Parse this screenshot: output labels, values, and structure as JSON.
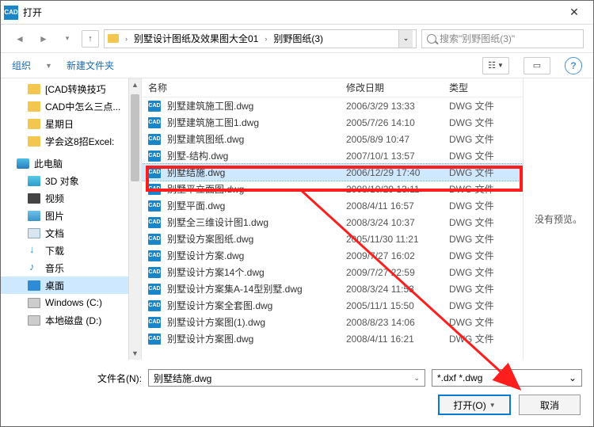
{
  "window": {
    "title": "打开"
  },
  "nav": {
    "crumbs": [
      "别墅设计图纸及效果图大全01",
      "别野图纸(3)"
    ],
    "search_placeholder": "搜索\"别野图纸(3)\""
  },
  "toolbar": {
    "organize": "组织",
    "newfolder": "新建文件夹"
  },
  "tree": {
    "items": [
      {
        "label": "[CAD转换技巧",
        "icon": "ico-folder",
        "level": 1
      },
      {
        "label": "CAD中怎么三点...",
        "icon": "ico-folder",
        "level": 1
      },
      {
        "label": "星期日",
        "icon": "ico-folder",
        "level": 1
      },
      {
        "label": "学会这8招Excel:",
        "icon": "ico-folder",
        "level": 1
      },
      {
        "label": "此电脑",
        "icon": "ico-pc",
        "level": 0,
        "hdr": true
      },
      {
        "label": "3D 对象",
        "icon": "ico-3d",
        "level": 1
      },
      {
        "label": "视频",
        "icon": "ico-video",
        "level": 1
      },
      {
        "label": "图片",
        "icon": "ico-pic",
        "level": 1
      },
      {
        "label": "文档",
        "icon": "ico-doc",
        "level": 1
      },
      {
        "label": "下载",
        "icon": "ico-dl",
        "level": 1
      },
      {
        "label": "音乐",
        "icon": "ico-music",
        "level": 1
      },
      {
        "label": "桌面",
        "icon": "ico-desktop",
        "level": 1,
        "sel": true
      },
      {
        "label": "Windows (C:)",
        "icon": "ico-disk",
        "level": 1
      },
      {
        "label": "本地磁盘 (D:)",
        "icon": "ico-disk",
        "level": 1
      }
    ]
  },
  "cols": {
    "name": "名称",
    "date": "修改日期",
    "type": "类型"
  },
  "files": [
    {
      "name": "别墅建筑施工图.dwg",
      "date": "2006/3/29 13:33",
      "type": "DWG 文件"
    },
    {
      "name": "别墅建筑施工图1.dwg",
      "date": "2005/7/26 14:10",
      "type": "DWG 文件"
    },
    {
      "name": "别墅建筑图纸.dwg",
      "date": "2005/8/9 10:47",
      "type": "DWG 文件"
    },
    {
      "name": "别墅-结构.dwg",
      "date": "2007/10/1 13:57",
      "type": "DWG 文件"
    },
    {
      "name": "别墅结施.dwg",
      "date": "2006/12/29 17:40",
      "type": "DWG 文件",
      "sel": true
    },
    {
      "name": "别墅平立面图.dwg",
      "date": "2008/10/29 13:11",
      "type": "DWG 文件"
    },
    {
      "name": "别墅平面.dwg",
      "date": "2008/4/11 16:57",
      "type": "DWG 文件"
    },
    {
      "name": "别墅全三维设计图1.dwg",
      "date": "2008/3/24 10:37",
      "type": "DWG 文件"
    },
    {
      "name": "别墅设方案图纸.dwg",
      "date": "2005/11/30 11:21",
      "type": "DWG 文件"
    },
    {
      "name": "别墅设计方案.dwg",
      "date": "2009/7/27 16:02",
      "type": "DWG 文件"
    },
    {
      "name": "别墅设计方案14个.dwg",
      "date": "2009/7/27 22:59",
      "type": "DWG 文件"
    },
    {
      "name": "别墅设计方案集A-14型别墅.dwg",
      "date": "2008/3/24 11:53",
      "type": "DWG 文件"
    },
    {
      "name": "别墅设计方案全套图.dwg",
      "date": "2005/11/1 15:50",
      "type": "DWG 文件"
    },
    {
      "name": "别墅设计方案图(1).dwg",
      "date": "2008/8/23 14:06",
      "type": "DWG 文件"
    },
    {
      "name": "别墅设计方案图.dwg",
      "date": "2008/4/11 16:21",
      "type": "DWG 文件"
    }
  ],
  "preview": "没有预览。",
  "footer": {
    "filename_label": "文件名(N):",
    "filename_value": "别墅结施.dwg",
    "filter": "*.dxf *.dwg",
    "open_label": "打开(O)",
    "cancel_label": "取消"
  }
}
